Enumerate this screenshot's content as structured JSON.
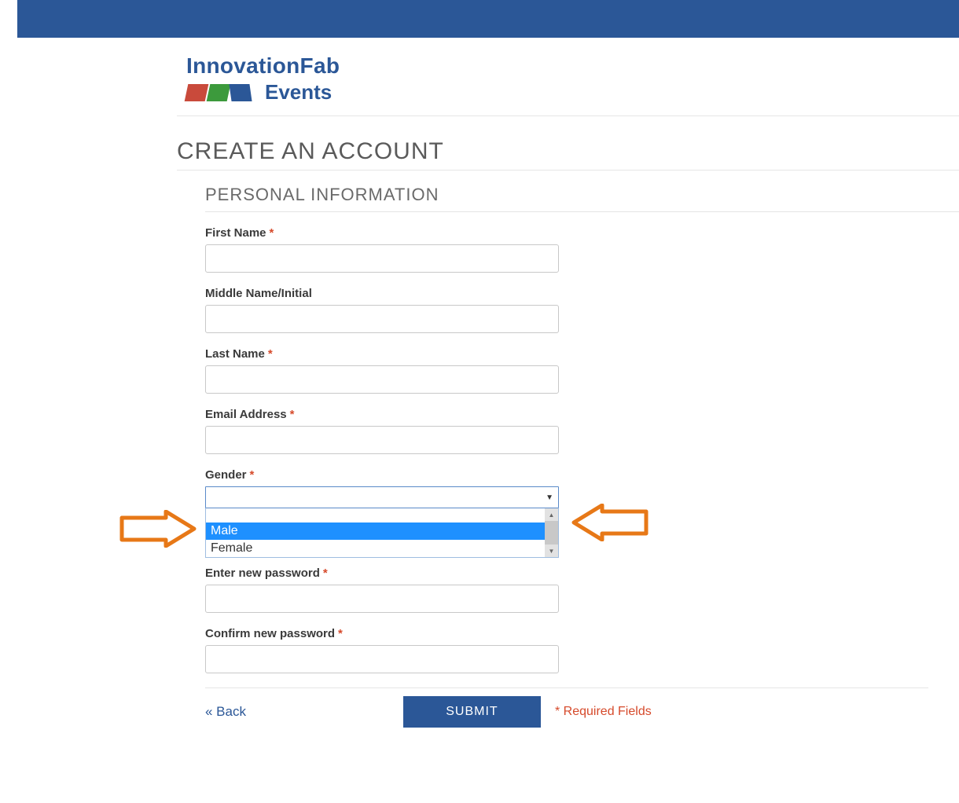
{
  "brand": {
    "line1": "InnovationFab",
    "line2": "Events"
  },
  "page": {
    "title": "CREATE AN ACCOUNT",
    "section": "PERSONAL INFORMATION"
  },
  "fields": {
    "first_name": {
      "label": "First Name",
      "required": true,
      "value": ""
    },
    "middle_name": {
      "label": "Middle Name/Initial",
      "required": false,
      "value": ""
    },
    "last_name": {
      "label": "Last Name",
      "required": true,
      "value": ""
    },
    "email": {
      "label": "Email Address",
      "required": true,
      "value": ""
    },
    "gender": {
      "label": "Gender",
      "required": true,
      "selected": "",
      "options_blank": "",
      "options": [
        "Male",
        "Female"
      ],
      "highlighted": "Male"
    },
    "new_password": {
      "label": "Enter new password",
      "required": true,
      "value": ""
    },
    "confirm_password": {
      "label": "Confirm new password",
      "required": true,
      "value": ""
    }
  },
  "footer": {
    "back": "« Back",
    "submit": "SUBMIT",
    "required_note": "* Required Fields"
  },
  "asterisk": "*"
}
